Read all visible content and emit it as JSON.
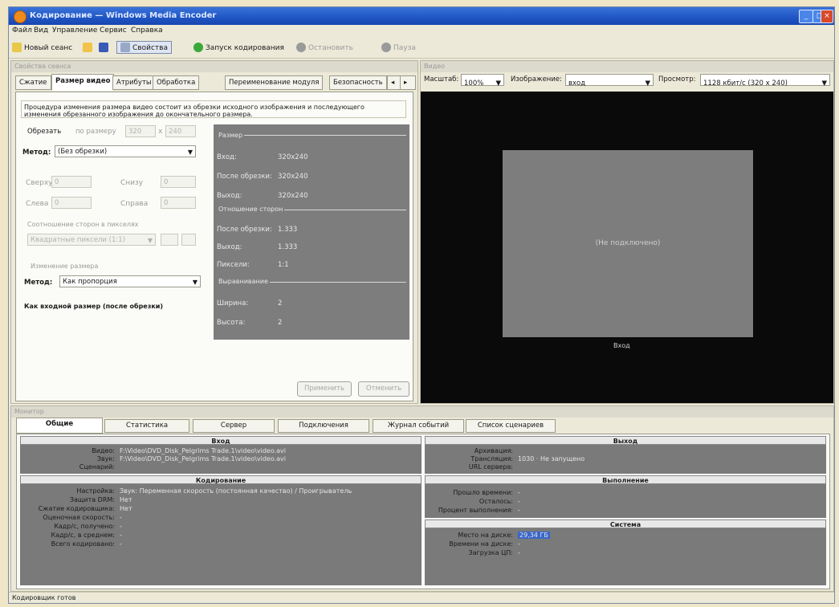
{
  "window": {
    "title": "Кодирование — Windows Media Encoder"
  },
  "menu": [
    "Файл",
    "Вид",
    "Управление",
    "Сервис",
    "Справка"
  ],
  "toolbar": {
    "new_session": "Новый сеанс",
    "properties": "Свойства",
    "start": "Запуск кодирования",
    "stop": "Остановить",
    "pause": "Пауза"
  },
  "left_panel": {
    "title": "Свойства сеанса",
    "tabs": [
      "Сжатие",
      "Размер видео",
      "Атрибуты",
      "Обработка",
      "Переименование модуля",
      "Безопасность"
    ],
    "active_tab": 1,
    "description": "Процедура изменения размера видео состоит из обрезки исходного изображения и последующего изменения обрезанного изображения до окончательного размера.",
    "crop_label": "Обрезать",
    "crop_by": "по размеру",
    "crop_w": "320",
    "crop_h": "240",
    "method_label": "Метод:",
    "method_value": "(Без обрезки)",
    "top_label": "Сверху",
    "top_value": "0",
    "left_label": "Слева",
    "left_value": "0",
    "bottom_label": "Снизу",
    "bottom_value": "0",
    "right_label": "Справа",
    "right_value": "0",
    "aspect_group": "Соотношение сторон в пикселях",
    "aspect_value": "Квадратные пиксели (1:1)",
    "resize_group": "Изменение размера",
    "resize_method_label": "Метод:",
    "resize_method_value": "Как пропорция",
    "result_text": "Как входной размер (после обрезки)",
    "info": {
      "size_section": "Размер",
      "input_label": "Вход:",
      "input_value": "320x240",
      "after_crop_label": "После обрезки:",
      "after_crop_value": "320x240",
      "output_label": "Выход:",
      "output_value": "320x240",
      "aspect_section": "Отношение сторон",
      "a_after_crop_label": "После обрезки:",
      "a_after_crop_value": "1.333",
      "a_output_label": "Выход:",
      "a_output_value": "1.333",
      "pixels_label": "Пиксели:",
      "pixels_value": "1:1",
      "align_section": "Выравнивание",
      "width_label": "Ширина:",
      "width_value": "2",
      "height_label": "Высота:",
      "height_value": "2"
    },
    "apply_button": "Применить",
    "cancel_button": "Отменить"
  },
  "preview": {
    "title": "Видео",
    "zoom_label": "Масштаб:",
    "zoom_value": "100%",
    "image_label": "Изображение:",
    "image_value": "вход",
    "view_label": "Просмотр:",
    "view_value": "1128 кбит/с (320 x 240)",
    "placeholder": "(Не подключено)",
    "caption": "Вход"
  },
  "bottom": {
    "title": "Монитор",
    "tabs": [
      "Общие",
      "Статистика",
      "Сервер",
      "Подключения",
      "Журнал событий",
      "Список сценариев"
    ],
    "input_header": "Вход",
    "input_rows": [
      {
        "label": "Видео:",
        "value": "F:\\Video\\DVD_Disk_Pelgrims Trade.1\\video\\video.avi"
      },
      {
        "label": "Звук:",
        "value": "F:\\Video\\DVD_Disk_Pelgrims Trade.1\\video\\video.avi"
      },
      {
        "label": "Сценарий:",
        "value": ""
      }
    ],
    "output_header": "Выход",
    "output_rows": [
      {
        "label": "Архивация:",
        "value": ""
      },
      {
        "label": "Трансляция:",
        "value": "1030 · Не запущено"
      },
      {
        "label": "URL сервера:",
        "value": ""
      }
    ],
    "encoding_header": "Кодирование",
    "encoding_rows": [
      {
        "label": "Настройка:",
        "value": "Звук: Переменная скорость (постоянная качество) / Проигрыватель"
      },
      {
        "label": "Защита DRM:",
        "value": "Нет"
      },
      {
        "label": "Сжатие кодировщика:",
        "value": "Нет"
      },
      {
        "label": "Оценочная скорость:",
        "value": "-"
      },
      {
        "label": "Кадр/с, получено:",
        "value": "-"
      },
      {
        "label": "Кадр/с, в среднем:",
        "value": "-"
      },
      {
        "label": "Всего кодировано:",
        "value": "-"
      }
    ],
    "progress_header": "Выполнение",
    "progress_rows": [
      {
        "label": "Прошло времени:",
        "value": "-"
      },
      {
        "label": "Осталось:",
        "value": "-"
      },
      {
        "label": "Процент выполнения:",
        "value": "-"
      }
    ],
    "system_header": "Система",
    "system_rows": [
      {
        "label": "Место на диске:",
        "value": "29,34 ГБ"
      },
      {
        "label": "Времени на диске:",
        "value": "-"
      },
      {
        "label": "Загрузка ЦП:",
        "value": "-"
      }
    ]
  },
  "status": "Кодировщик готов"
}
